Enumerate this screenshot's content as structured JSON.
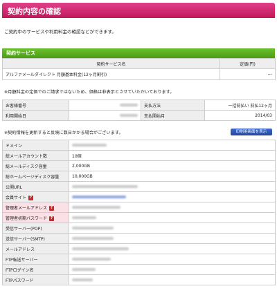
{
  "page": {
    "title": "契約内容の確認",
    "intro": "ご契約中のサービスや利用料金の確認などができます。"
  },
  "services": {
    "section_title": "契約サービス",
    "headers": [
      "契約サービス名",
      "定価(円)"
    ],
    "rows": [
      {
        "name": "アルファメールダイレクト 月額基本料金(12ヶ月割引)",
        "price": "---"
      }
    ]
  },
  "notice1": "※月額料金の定価でのご請求ではないため、価格は非表示とさせていただいております。",
  "customer": {
    "customer_number_label": "お客様番号",
    "payment_method_label": "支払方法",
    "payment_method_value": "一括前払い 前払12ヶ月",
    "start_date_label": "利用開始日",
    "payment_start_label": "支払開始月",
    "payment_start_value": "2014/03"
  },
  "notice2": "※契約情報を更新すると反映に数日かかる場合がございます。",
  "print_button": "印刷用画面を表示",
  "details": [
    {
      "label": "ドメイン",
      "value": "",
      "blur": true,
      "blur_w": 50
    },
    {
      "label": "総メールアカウント数",
      "value": "10個",
      "blur": false
    },
    {
      "label": "総メールディスク容量",
      "value": "2,000GB",
      "blur": false
    },
    {
      "label": "総ホームページディスク容量",
      "value": "10,000GB",
      "blur": false
    },
    {
      "label": "公開URL",
      "value": "",
      "blur": true,
      "blur_w": 95
    },
    {
      "label": "会員サイト",
      "value": "",
      "blur": true,
      "blur_w": 78,
      "link": true,
      "help": true
    },
    {
      "label": "管理者メールアドレス",
      "value": "",
      "blur": true,
      "blur_w": 70,
      "pink": true,
      "help": true
    },
    {
      "label": "管理者初期パスワード",
      "value": "",
      "blur": true,
      "blur_w": 35,
      "pink": true,
      "help": true
    },
    {
      "label": "受信サーバー(POP)",
      "value": "",
      "blur": true,
      "blur_w": 60
    },
    {
      "label": "送信サーバー(SMTP)",
      "value": "",
      "blur": true,
      "blur_w": 60
    },
    {
      "label": "メールアドレス",
      "value": "",
      "blur": true,
      "blur_w": 82
    },
    {
      "label": "FTP転送サーバー",
      "value": "",
      "blur": true,
      "blur_w": 56
    },
    {
      "label": "FTPログイン名",
      "value": "",
      "blur": true,
      "blur_w": 34
    },
    {
      "label": "FTPパスワード",
      "value": "",
      "blur": true,
      "blur_w": 30
    }
  ],
  "icons": {
    "help": "question-icon"
  },
  "colors": {
    "title_bar": "#d0306e",
    "section_bar": "#5aae1e",
    "print_button": "#2f57b5",
    "help_icon": "#c62828"
  }
}
